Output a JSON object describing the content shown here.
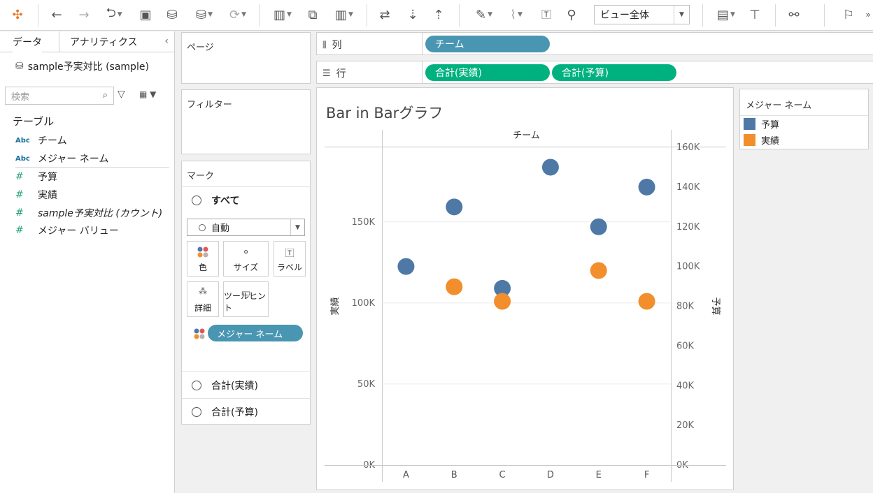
{
  "toolbar": {
    "view_select": "ビュー全体"
  },
  "datapane": {
    "tabs": [
      "データ",
      "アナリティクス"
    ],
    "datasource": "sample予実対比 (sample)",
    "search_placeholder": "検索",
    "section_title": "テーブル",
    "dimensions": [
      {
        "type": "Abc",
        "name": "チーム"
      },
      {
        "type": "Abc",
        "name": "メジャー ネーム"
      }
    ],
    "measures": [
      {
        "type": "#",
        "name": "予算"
      },
      {
        "type": "#",
        "name": "実績"
      },
      {
        "type": "#",
        "name": "sample予実対比 (カウント)"
      },
      {
        "type": "#",
        "name": "メジャー バリュー"
      }
    ]
  },
  "shelves": {
    "pages_title": "ページ",
    "filters_title": "フィルター",
    "columns_label": "列",
    "rows_label": "行",
    "columns_pills": [
      "チーム"
    ],
    "rows_pills": [
      "合計(実績)",
      "合計(予算)"
    ]
  },
  "marks": {
    "title": "マーク",
    "all_label": "すべて",
    "mark_type": "自動",
    "buttons": [
      "色",
      "サイズ",
      "ラベル",
      "詳細",
      "ツールヒント"
    ],
    "color_pill": "メジャー ネーム",
    "measure_rows": [
      "合計(実績)",
      "合計(予算)"
    ]
  },
  "view": {
    "title": "Bar in Barグラフ",
    "header": "チーム",
    "left_axis_label": "実績",
    "right_axis_label": "予算"
  },
  "legend": {
    "title": "メジャー ネーム",
    "items": [
      {
        "label": "予算",
        "color": "#4e79a7"
      },
      {
        "label": "実績",
        "color": "#f28e2b"
      }
    ]
  },
  "chart_data": {
    "type": "scatter",
    "title": "Bar in Barグラフ",
    "categories": [
      "A",
      "B",
      "C",
      "D",
      "E",
      "F"
    ],
    "left_axis": {
      "label": "実績",
      "range": [
        0,
        196000
      ],
      "ticks": [
        "0K",
        "50K",
        "100K",
        "150K"
      ],
      "tick_values": [
        0,
        50000,
        100000,
        150000
      ]
    },
    "right_axis": {
      "label": "予算",
      "range": [
        0,
        160000
      ],
      "ticks": [
        "0K",
        "20K",
        "40K",
        "60K",
        "80K",
        "100K",
        "120K",
        "140K",
        "160K"
      ],
      "tick_values": [
        0,
        20000,
        40000,
        60000,
        80000,
        100000,
        120000,
        140000,
        160000
      ]
    },
    "series": [
      {
        "name": "予算",
        "axis": "right",
        "color": "#4e79a7",
        "values": [
          100000,
          130000,
          89000,
          150000,
          120000,
          140000
        ]
      },
      {
        "name": "実績",
        "axis": "left",
        "color": "#f28e2b",
        "values": [
          null,
          110000,
          101000,
          null,
          120000,
          101000
        ]
      }
    ],
    "grid": true,
    "legend": "right"
  }
}
